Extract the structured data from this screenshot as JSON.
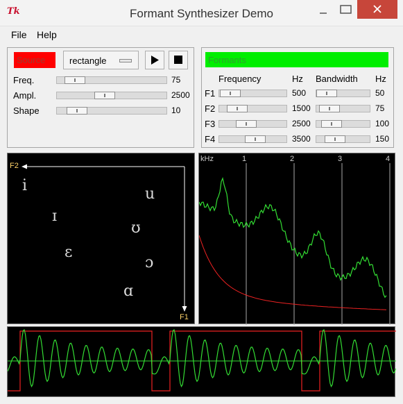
{
  "window": {
    "title": "Formant Synthesizer Demo",
    "icon": "tk-feather-icon",
    "controls": {
      "minimize": "–",
      "maximize": "▭",
      "close": "✕"
    }
  },
  "menu": {
    "items": [
      "File",
      "Help"
    ]
  },
  "source": {
    "label": "Source",
    "label_color": "#ff0000",
    "waveform": "rectangle",
    "play_icon": "play-icon",
    "stop_icon": "stop-icon",
    "sliders": [
      {
        "label": "Freq.",
        "value": "75",
        "fraction": 0.16
      },
      {
        "label": "Ampl.",
        "value": "2500",
        "fraction": 0.43
      },
      {
        "label": "Shape",
        "value": "10",
        "fraction": 0.18
      }
    ]
  },
  "formants": {
    "label": "Formants",
    "label_color": "#00ee00",
    "headers": {
      "frequency": "Frequency",
      "hz1": "Hz",
      "bandwidth": "Bandwidth",
      "hz2": "Hz"
    },
    "rows": [
      {
        "label": "F1",
        "freq": "500",
        "freq_frac": 0.16,
        "bw": "50",
        "bw_frac": 0.18
      },
      {
        "label": "F2",
        "freq": "1500",
        "freq_frac": 0.26,
        "bw": "75",
        "bw_frac": 0.24
      },
      {
        "label": "F3",
        "freq": "2500",
        "freq_frac": 0.39,
        "bw": "100",
        "bw_frac": 0.28
      },
      {
        "label": "F4",
        "freq": "3500",
        "freq_frac": 0.53,
        "bw": "150",
        "bw_frac": 0.34
      }
    ]
  },
  "vowel_chart": {
    "axis_x_label": "F2",
    "axis_y_label": "F1",
    "vowels": [
      "i",
      "ɪ",
      "ɛ",
      "u",
      "ʊ",
      "ɔ",
      "ɑ"
    ]
  },
  "spectrum": {
    "unit_label": "kHz",
    "ticks": [
      "1",
      "2",
      "3",
      "4"
    ],
    "colors": {
      "spectrum": "#33dd33",
      "source": "#ee2222"
    }
  },
  "waveform": {
    "colors": {
      "output": "#33dd33",
      "source": "#ee2222"
    }
  }
}
